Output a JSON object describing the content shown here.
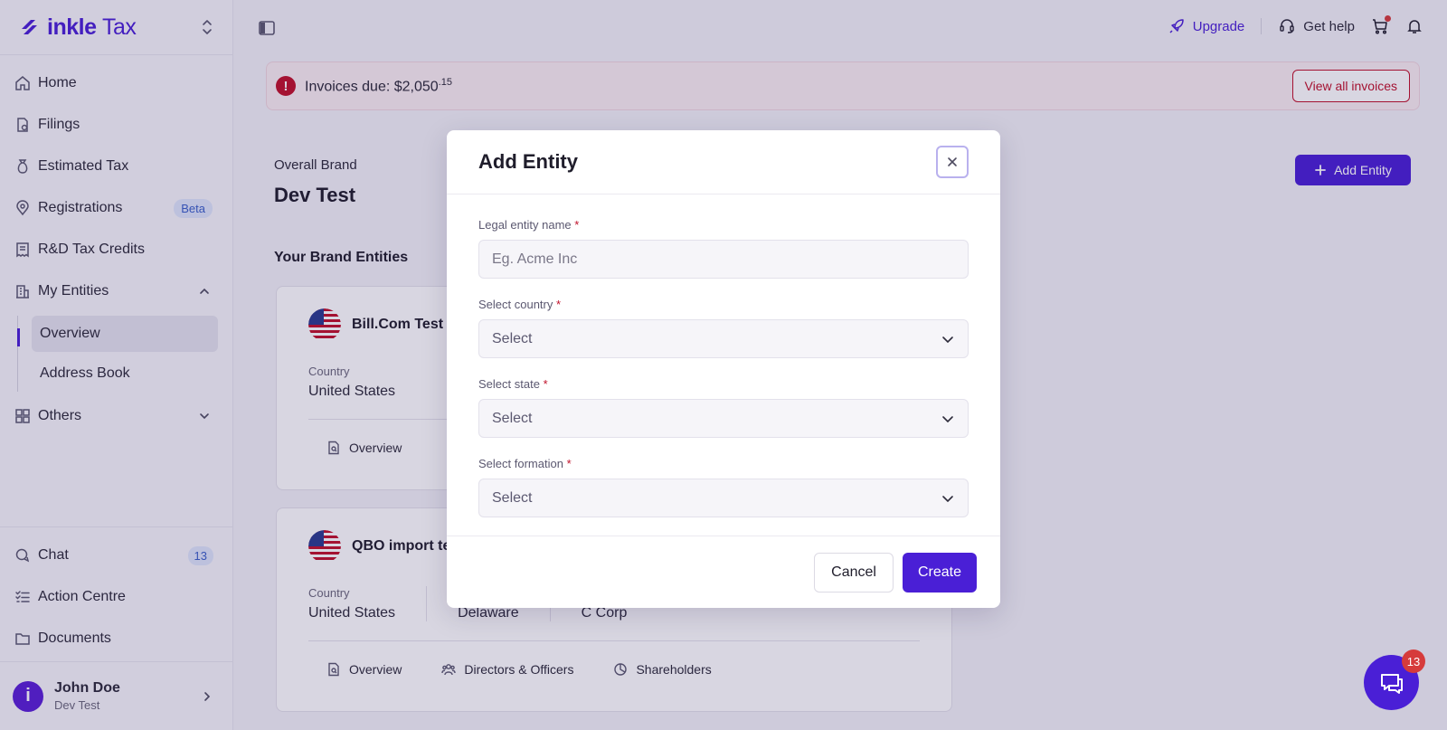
{
  "app": {
    "logo_word": "inkle",
    "logo_suffix": "Tax"
  },
  "sidebar": {
    "items": [
      {
        "label": "Home",
        "icon": "home-icon"
      },
      {
        "label": "Filings",
        "icon": "filings-icon"
      },
      {
        "label": "Estimated Tax",
        "icon": "money-bag-icon"
      },
      {
        "label": "Registrations",
        "icon": "location-pin-icon",
        "badge": "Beta"
      },
      {
        "label": "R&D Tax Credits",
        "icon": "receipt-icon"
      },
      {
        "label": "My Entities",
        "icon": "building-icon",
        "expanded": true
      }
    ],
    "sub_items": [
      {
        "label": "Overview",
        "active": true
      },
      {
        "label": "Address Book",
        "active": false
      }
    ],
    "others": {
      "label": "Others",
      "icon": "grid-icon"
    },
    "bottom_items": [
      {
        "label": "Chat",
        "icon": "chat-icon",
        "badge": "13"
      },
      {
        "label": "Action Centre",
        "icon": "checklist-icon"
      },
      {
        "label": "Documents",
        "icon": "folder-icon"
      }
    ],
    "user": {
      "initial": "i",
      "name": "John Doe",
      "org": "Dev Test"
    }
  },
  "topbar": {
    "upgrade_label": "Upgrade",
    "help_label": "Get help"
  },
  "invoice_banner": {
    "label": "Invoices due: $2,050",
    "cents": ".15",
    "button_label": "View all invoices"
  },
  "page": {
    "brand_label": "Overall Brand",
    "brand_name": "Dev Test",
    "entities_label": "Your Brand Entities",
    "add_entity_label": "Add Entity"
  },
  "cards": [
    {
      "title": "Bill.Com Test",
      "fields": [
        {
          "label": "Country",
          "value": "United States"
        }
      ],
      "tabs": [
        {
          "label": "Overview",
          "icon": "document-search-icon"
        }
      ]
    },
    {
      "title": "QBO import te",
      "fields": [
        {
          "label": "Country",
          "value": "United States"
        },
        {
          "label": "",
          "value": "Delaware"
        },
        {
          "label": "",
          "value": "C Corp"
        }
      ],
      "tabs": [
        {
          "label": "Overview",
          "icon": "document-search-icon"
        },
        {
          "label": "Directors & Officers",
          "icon": "people-icon"
        },
        {
          "label": "Shareholders",
          "icon": "pie-icon"
        }
      ]
    }
  ],
  "modal": {
    "title": "Add Entity",
    "fields": {
      "entity_name": {
        "label": "Legal entity name",
        "placeholder": "Eg. Acme Inc",
        "value": ""
      },
      "country": {
        "label": "Select country",
        "value": "Select"
      },
      "state": {
        "label": "Select state",
        "value": "Select"
      },
      "formation": {
        "label": "Select formation",
        "value": "Select"
      }
    },
    "required_mark": "*",
    "cancel_label": "Cancel",
    "create_label": "Create"
  },
  "chat_fab": {
    "badge": "13"
  },
  "colors": {
    "brand": "#4a1fd6",
    "danger": "#c0112a",
    "badge_red": "#d63b3b"
  }
}
